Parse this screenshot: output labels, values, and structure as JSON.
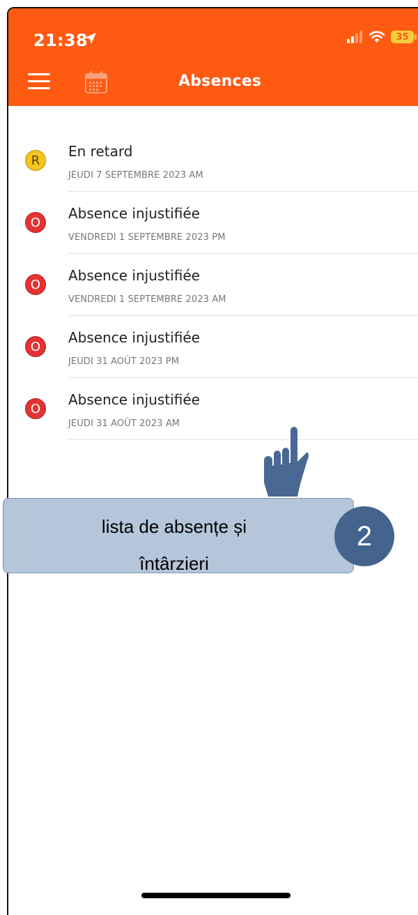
{
  "status_bar": {
    "time": "21:38",
    "battery": "35"
  },
  "header": {
    "title": "Absences",
    "background_color": "#ff5a12"
  },
  "absences": [
    {
      "badge": "R",
      "badge_color": "#f5c51e",
      "title": "En retard",
      "date": "JEUDI 7 SEPTEMBRE 2023 AM"
    },
    {
      "badge": "O",
      "badge_color": "#e53232",
      "title": "Absence injustifiée",
      "date": "VENDREDI 1 SEPTEMBRE 2023 PM"
    },
    {
      "badge": "O",
      "badge_color": "#e53232",
      "title": "Absence injustifiée",
      "date": "VENDREDI 1 SEPTEMBRE 2023 AM"
    },
    {
      "badge": "O",
      "badge_color": "#e53232",
      "title": "Absence injustifiée",
      "date": "JEUDI 31 AOÛT 2023 PM"
    },
    {
      "badge": "O",
      "badge_color": "#e53232",
      "title": "Absence injustifiée",
      "date": "JEUDI 31 AOÛT 2023 AM"
    }
  ],
  "annotation": {
    "line1": "lista de absențe și",
    "line2": "întârzieri",
    "step": "2",
    "icon": "pointing-hand-icon"
  }
}
